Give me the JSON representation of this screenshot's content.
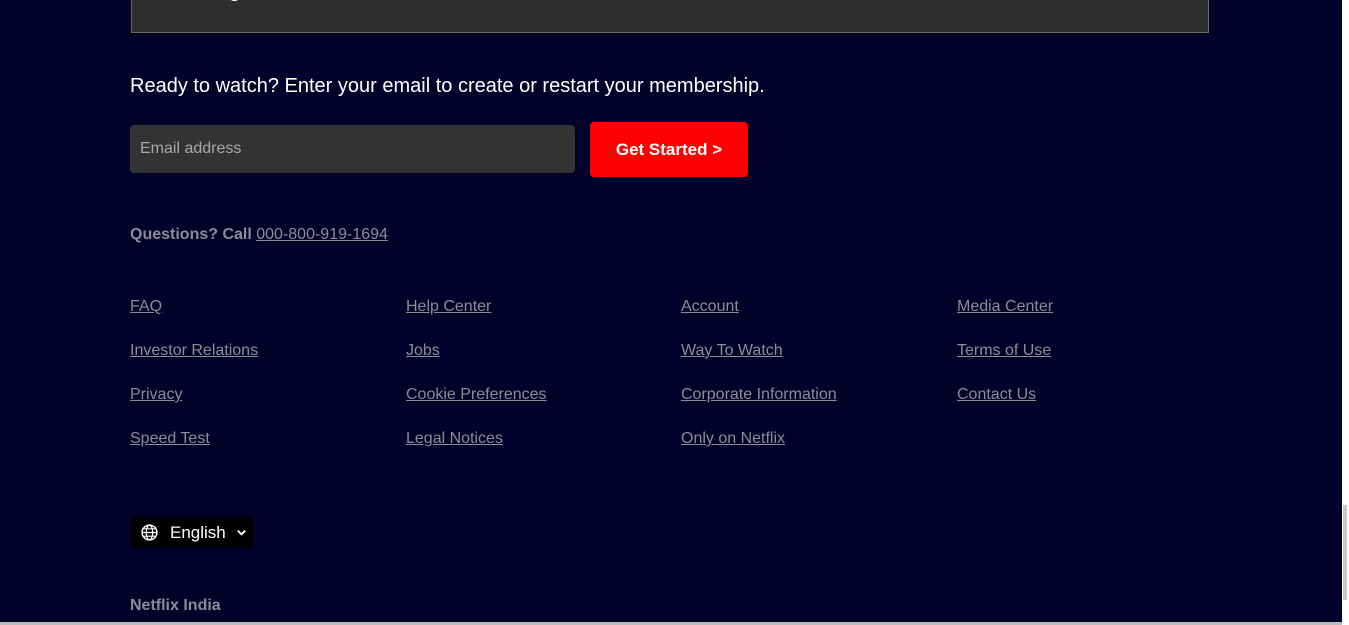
{
  "faq_item": {
    "visible_text_fragment": "g"
  },
  "cta": {
    "text": "Ready to watch? Enter your email to create or restart your membership.",
    "email_placeholder": "Email address",
    "button_label": "Get Started >"
  },
  "questions": {
    "prefix": "Questions? Call",
    "phone": "000-800-919-1694"
  },
  "footer_links": {
    "col1": [
      "FAQ",
      "Investor Relations",
      "Privacy",
      "Speed Test"
    ],
    "col2": [
      "Help Center",
      "Jobs",
      "Cookie Preferences",
      "Legal Notices"
    ],
    "col3": [
      "Account",
      "Way To Watch",
      "Corporate Information",
      "Only on Netflix"
    ],
    "col4": [
      "Media Center",
      "Terms of Use",
      "Contact Us"
    ]
  },
  "language": {
    "icon": "globe-icon",
    "selected": "English",
    "chevron_icon": "chevron-down-icon"
  },
  "country": "Netflix India",
  "colors": {
    "background": "#02012a",
    "accent": "#ff0000",
    "muted_text": "#8c8c95",
    "input_bg": "#333333"
  }
}
